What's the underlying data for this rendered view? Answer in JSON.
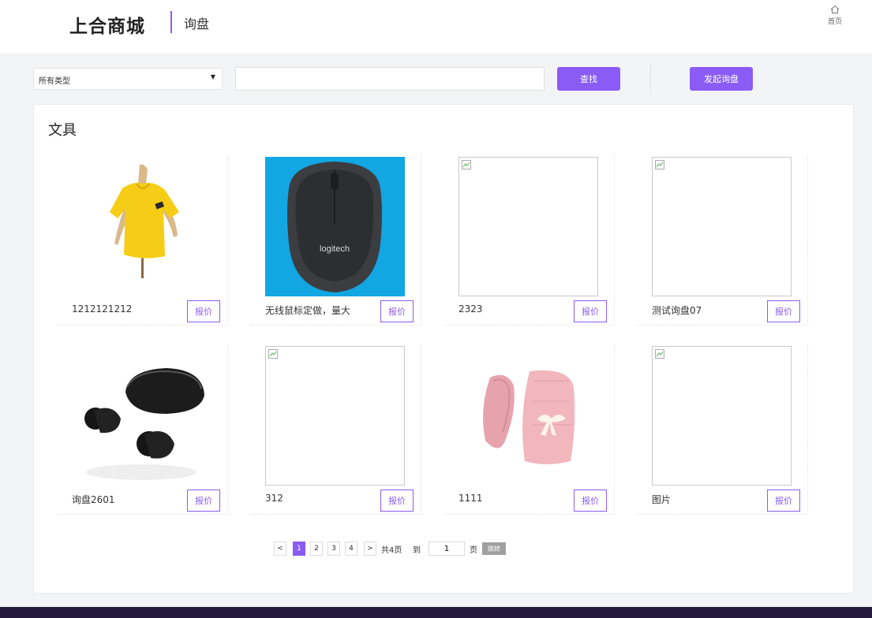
{
  "header": {
    "brand": "上合商城",
    "page_name": "询盘",
    "home_label": "首页",
    "home_icon": "home-icon"
  },
  "search": {
    "category_select": "所有类型",
    "query_value": "",
    "search_label": "查找",
    "inquiry_label": "发起询盘"
  },
  "category": {
    "title": "文具"
  },
  "products": [
    {
      "name": "1212121212",
      "action": "报价",
      "image": "yellow-tshirt"
    },
    {
      "name": "无线鼠标定做，量大",
      "action": "报价",
      "image": "logitech-mouse"
    },
    {
      "name": "2323",
      "action": "报价",
      "image": "broken"
    },
    {
      "name": "测试询盘07",
      "action": "报价",
      "image": "broken"
    },
    {
      "name": "询盘2601",
      "action": "报价",
      "image": "wireless-earbuds"
    },
    {
      "name": "312",
      "action": "报价",
      "image": "broken"
    },
    {
      "name": "1111",
      "action": "报价",
      "image": "pink-bunny-plush"
    },
    {
      "name": "图片",
      "action": "报价",
      "image": "broken"
    }
  ],
  "pagination": {
    "prev": "<",
    "pages": [
      "1",
      "2",
      "3",
      "4"
    ],
    "current": "1",
    "next": ">",
    "total_text": "共4页",
    "to_label": "到",
    "jump_value": "1",
    "page_unit": "页",
    "jump_label": "跳转"
  },
  "colors": {
    "accent": "#8a5cf5",
    "footer": "#27193d",
    "page_bg": "#f3f4f6"
  }
}
